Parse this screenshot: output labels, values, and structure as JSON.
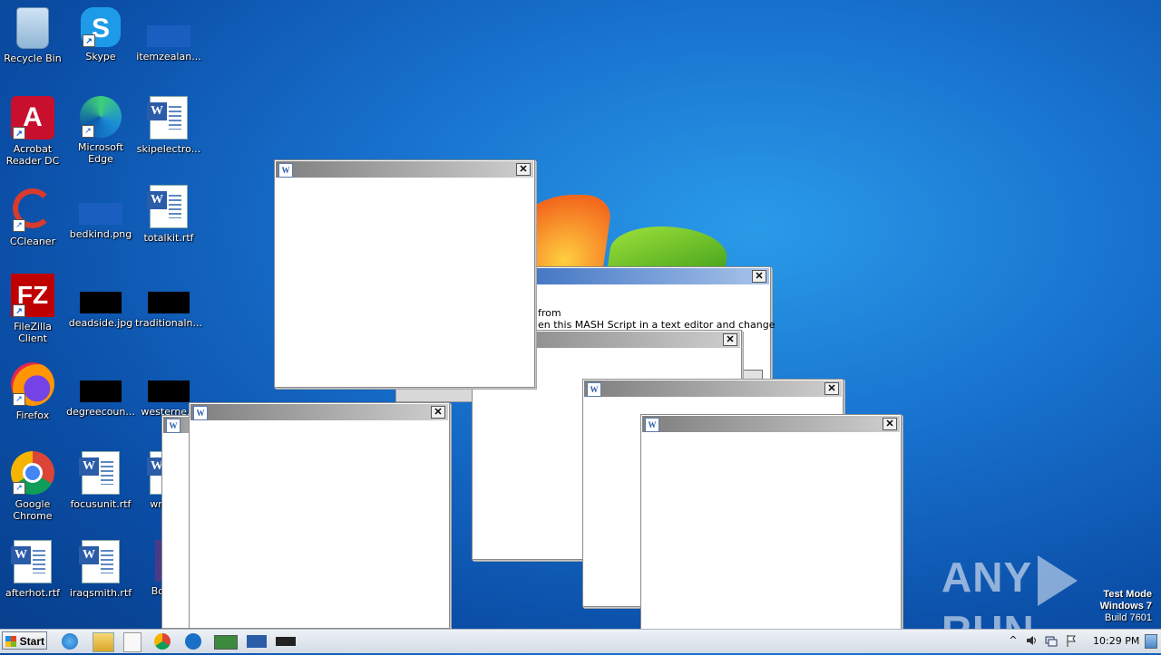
{
  "desktop": {
    "icons": [
      {
        "label": "Recycle Bin"
      },
      {
        "label": "Skype"
      },
      {
        "label": "itemzealan..."
      },
      {
        "label": "Acrobat Reader DC"
      },
      {
        "label": "Microsoft Edge"
      },
      {
        "label": "skipelectro..."
      },
      {
        "label": "CCleaner"
      },
      {
        "label": "bedkind.png"
      },
      {
        "label": "totalkit.rtf"
      },
      {
        "label": "FileZilla Client"
      },
      {
        "label": "deadside.jpg"
      },
      {
        "label": "traditionaln..."
      },
      {
        "label": "Firefox"
      },
      {
        "label": "degreecoun..."
      },
      {
        "label": "westerne..."
      },
      {
        "label": "Google Chrome"
      },
      {
        "label": "focusunit.rtf"
      },
      {
        "label": "wrote..."
      },
      {
        "label": "afterhot.rtf"
      },
      {
        "label": "iraqsmith.rtf"
      },
      {
        "label": "Bona..."
      }
    ]
  },
  "dialog": {
    "line1": "from",
    "line2": "en this MASH Script in a text editor and change"
  },
  "window_close_glyph": "✕",
  "taskbar": {
    "start_label": "Start",
    "clock": "10:29 PM"
  },
  "watermark": {
    "line1": "Test Mode",
    "line2": "Windows 7",
    "line3": "Build 7601",
    "brand_left": "ANY",
    "brand_right": "RUN"
  }
}
